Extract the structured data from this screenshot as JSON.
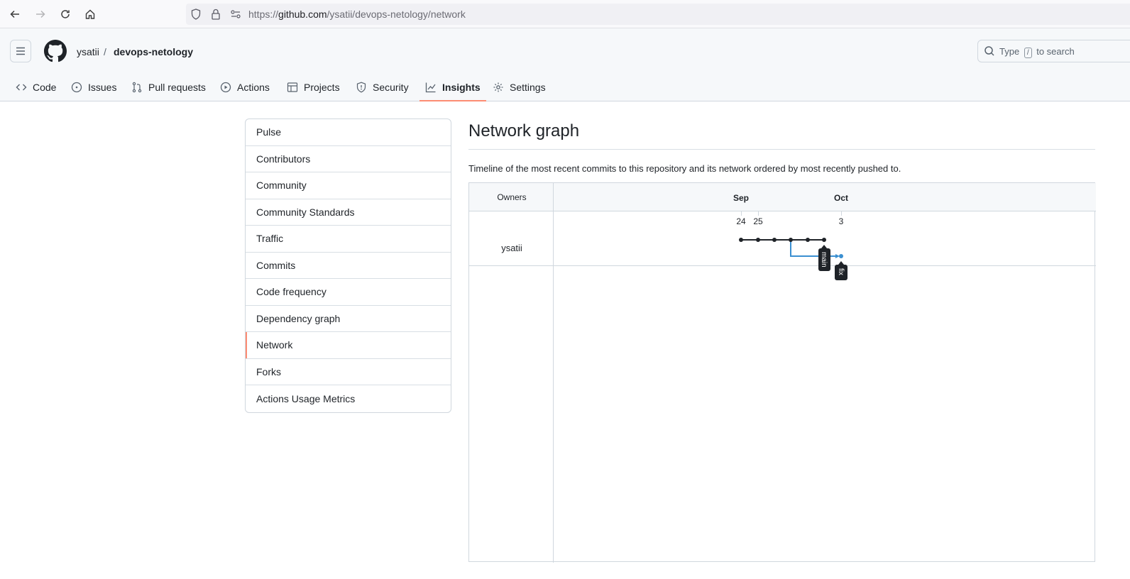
{
  "browser": {
    "url_scheme": "https://",
    "url_host": "github.com",
    "url_path": "/ysatii/devops-netology/network"
  },
  "header": {
    "owner": "ysatii",
    "separator": "/",
    "repo": "devops-netology",
    "search": {
      "prefix": "Type",
      "key": "/",
      "suffix": "to search"
    }
  },
  "tabs": [
    {
      "label": "Code",
      "icon": "code-icon"
    },
    {
      "label": "Issues",
      "icon": "issue-icon"
    },
    {
      "label": "Pull requests",
      "icon": "pull-request-icon"
    },
    {
      "label": "Actions",
      "icon": "play-icon"
    },
    {
      "label": "Projects",
      "icon": "table-icon"
    },
    {
      "label": "Security",
      "icon": "shield-icon"
    },
    {
      "label": "Insights",
      "icon": "graph-icon",
      "active": true
    },
    {
      "label": "Settings",
      "icon": "gear-icon"
    }
  ],
  "sidebar": {
    "items": [
      {
        "label": "Pulse"
      },
      {
        "label": "Contributors"
      },
      {
        "label": "Community"
      },
      {
        "label": "Community Standards"
      },
      {
        "label": "Traffic"
      },
      {
        "label": "Commits"
      },
      {
        "label": "Code frequency"
      },
      {
        "label": "Dependency graph"
      },
      {
        "label": "Network",
        "selected": true
      },
      {
        "label": "Forks"
      },
      {
        "label": "Actions Usage Metrics"
      }
    ]
  },
  "main": {
    "title": "Network graph",
    "description": "Timeline of the most recent commits to this repository and its network ordered by most recently pushed to."
  },
  "network": {
    "owners_header": "Owners",
    "owner": "ysatii",
    "months": [
      "Sep",
      "Oct"
    ],
    "days": [
      "24",
      "25",
      "3"
    ],
    "branches": [
      {
        "name": "main",
        "color": "#000000"
      },
      {
        "name": "fix",
        "color": "#3a8fd1"
      }
    ],
    "colors": {
      "accent": "#fd8c73",
      "branch_fix": "#3a8fd1"
    }
  }
}
